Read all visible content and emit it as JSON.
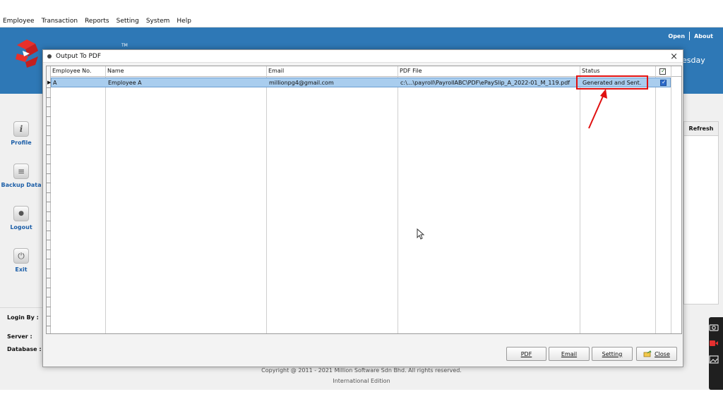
{
  "menu": [
    "Employee",
    "Transaction",
    "Reports",
    "Setting",
    "System",
    "Help"
  ],
  "banner": {
    "links": [
      "Open",
      "About"
    ],
    "day_fragment": "esday",
    "tm": "TM"
  },
  "sidenav": [
    {
      "label": "Profile",
      "icon": "info-icon",
      "glyph": "i"
    },
    {
      "label": "Backup Data",
      "icon": "database-icon",
      "glyph": "≡"
    },
    {
      "label": "Logout",
      "icon": "user-icon",
      "glyph": "●"
    },
    {
      "label": "Exit",
      "icon": "power-icon",
      "glyph": "⏻"
    }
  ],
  "right_panel": {
    "refresh": "Refresh"
  },
  "login_panel": {
    "login_by": "Login By :",
    "server": "Server :",
    "database": "Database :"
  },
  "footer": {
    "copyright": "Copyright @ 2011 - 2021 Million Software Sdn Bhd. All rights reserved.",
    "edition": "International Edition"
  },
  "dialog": {
    "title": "Output To PDF",
    "close_glyph": "×",
    "columns": [
      "Employee No.",
      "Name",
      "Email",
      "PDF File",
      "Status"
    ],
    "header_checked": true,
    "rows": [
      {
        "employee_no": "A",
        "name": "Employee A",
        "email": "millionpg4@gmail.com",
        "pdf_file": "c:\\...\\payroll\\PayrollABC\\PDF\\ePaySlip_A_2022-01_M_119.pdf",
        "status": "Generated and Sent.",
        "checked": true
      }
    ],
    "buttons": {
      "pdf": "PDF",
      "email": "Email",
      "setting": "Setting",
      "close": "Close"
    }
  },
  "colors": {
    "banner": "#2e78b6",
    "selection": "#a9cdee",
    "highlight": "#e01010",
    "nav_label": "#1d5fa8"
  }
}
